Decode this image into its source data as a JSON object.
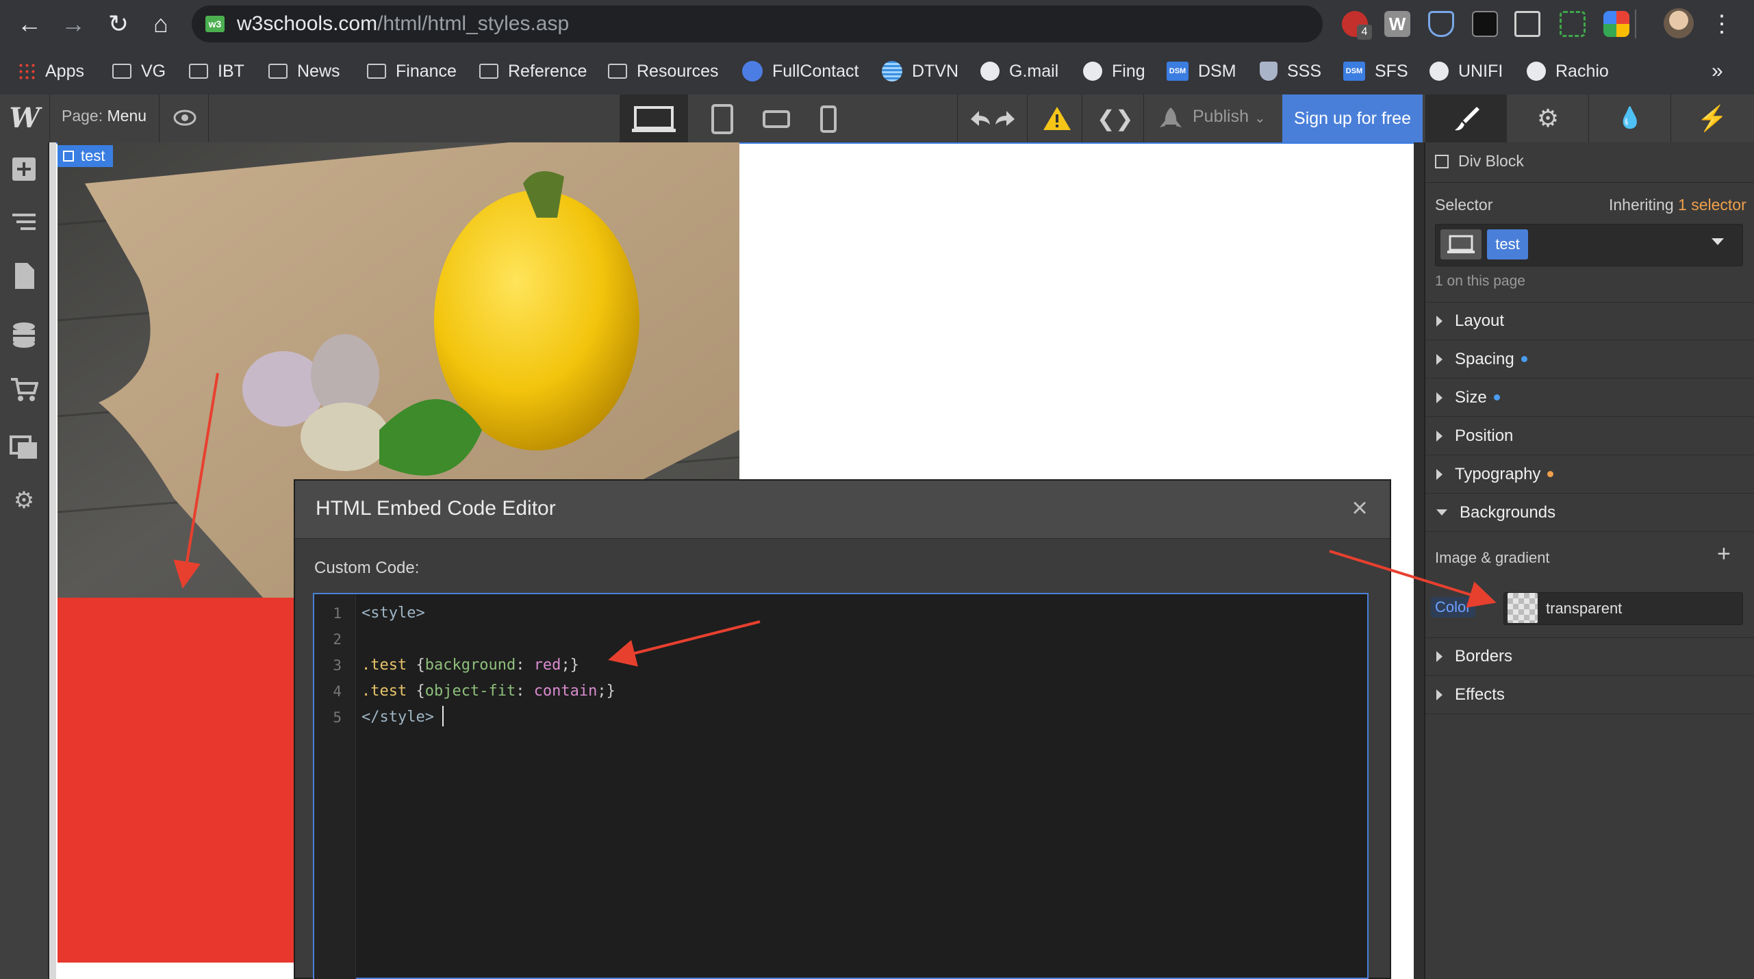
{
  "browser": {
    "url_host": "w3schools.com",
    "url_path": "/html/html_styles.asp",
    "favicon_label": "w3",
    "extension_badge": "4",
    "bookmarks": [
      "Apps",
      "VG",
      "IBT",
      "News",
      "Finance",
      "Reference",
      "Resources",
      "FullContact",
      "DTVN",
      "G.mail",
      "Fing",
      "DSM",
      "SSS",
      "SFS",
      "UNIFI",
      "Rachio"
    ],
    "bookmarks_more": "»",
    "dsm_badge": "DSM"
  },
  "webflow": {
    "logo": "W",
    "page_label": "Page:",
    "page_name": "Menu",
    "publish_label": "Publish",
    "signup_label": "Sign up for free",
    "code_icon": "❮❯"
  },
  "canvas": {
    "selected_element_tag": "test"
  },
  "modal": {
    "title": "HTML Embed Code Editor",
    "close": "×",
    "custom_code_label": "Custom Code:",
    "line_numbers": [
      "1",
      "2",
      "3",
      "4",
      "5"
    ],
    "code": {
      "l1_tag": "<style>",
      "l3_sel": ".test",
      "l3_open": " {",
      "l3_prop": "background",
      "l3_colon": ": ",
      "l3_val": "red",
      "l3_close": ";}",
      "l4_sel": ".test",
      "l4_open": " {",
      "l4_prop": "object-fit",
      "l4_colon": ": ",
      "l4_val": "contain",
      "l4_close": ";}",
      "l5_tag": "</style>"
    }
  },
  "right_panel": {
    "element_type": "Div Block",
    "selector_label": "Selector",
    "inheriting_label": "Inheriting",
    "inheriting_link": "1 selector",
    "selector_pill": "test",
    "on_page": "1 on this page",
    "sections": [
      {
        "label": "Layout",
        "dot": null
      },
      {
        "label": "Spacing",
        "dot": "#4a9cf0"
      },
      {
        "label": "Size",
        "dot": "#4a9cf0"
      },
      {
        "label": "Position",
        "dot": null
      },
      {
        "label": "Typography",
        "dot": "#f0a04b"
      },
      {
        "label": "Backgrounds",
        "dot": null
      }
    ],
    "image_gradient_label": "Image & gradient",
    "add_symbol": "+",
    "color_label": "Color",
    "color_value": "transparent",
    "sections_after": [
      "Borders",
      "Effects"
    ]
  },
  "colors": {
    "accent_blue": "#4a7fd9",
    "red_block": "#e8372c",
    "annotation_arrow": "#e8402f"
  }
}
